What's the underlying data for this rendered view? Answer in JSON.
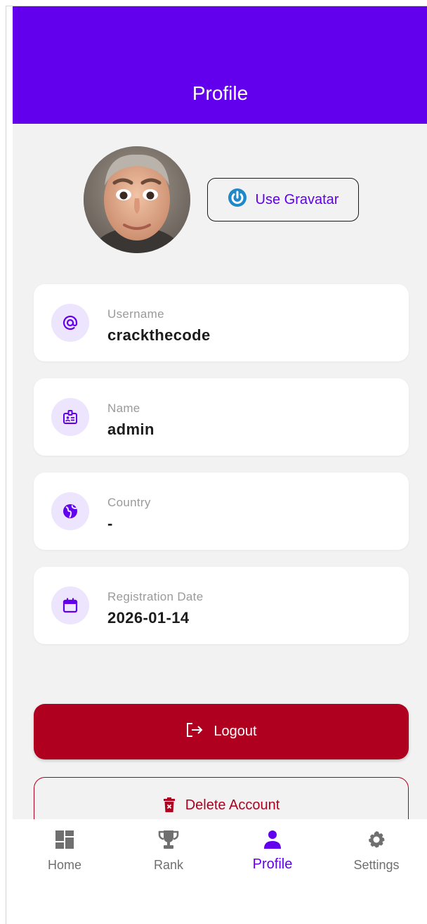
{
  "app": {
    "title": "Profile"
  },
  "colors": {
    "primary": "#6200ee",
    "danger": "#b00020",
    "background": "#f2f2f2",
    "icon_bg": "#ede4fd"
  },
  "profile": {
    "avatar_icon": "avatar-photo",
    "gravatar_button": {
      "label": "Use Gravatar",
      "icon": "power-icon"
    },
    "fields": [
      {
        "label": "Username",
        "value": "crackthecode",
        "icon": "at-icon"
      },
      {
        "label": "Name",
        "value": "admin",
        "icon": "badge-icon"
      },
      {
        "label": "Country",
        "value": "-",
        "icon": "globe-icon"
      },
      {
        "label": "Registration Date",
        "value": "2026-01-14",
        "icon": "calendar-icon"
      }
    ]
  },
  "actions": {
    "logout": {
      "label": "Logout",
      "icon": "logout-icon"
    },
    "delete": {
      "label": "Delete Account",
      "icon": "trash-icon"
    }
  },
  "bottom_nav": {
    "items": [
      {
        "label": "Home",
        "icon": "dashboard-icon",
        "active": false
      },
      {
        "label": "Rank",
        "icon": "trophy-icon",
        "active": false
      },
      {
        "label": "Profile",
        "icon": "person-icon",
        "active": true
      },
      {
        "label": "Settings",
        "icon": "gear-icon",
        "active": false
      }
    ]
  }
}
